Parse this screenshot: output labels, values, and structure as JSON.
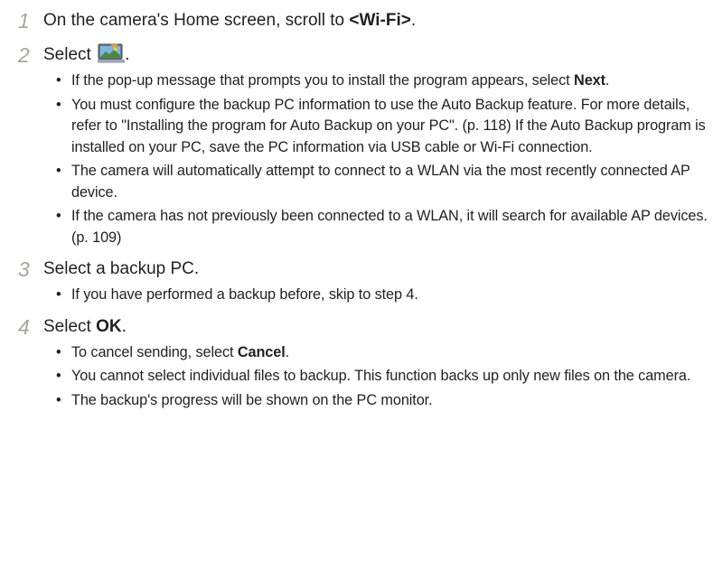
{
  "steps": [
    {
      "number": "1",
      "pre": "On the camera's Home screen, scroll to ",
      "bold": "<Wi-Fi>",
      "post": "."
    },
    {
      "number": "2",
      "pre": "Select ",
      "icon": "auto-backup-icon",
      "post": ".",
      "bullets": [
        {
          "pre": "If the pop-up message that prompts you to install the program appears, select ",
          "bold": "Next",
          "post": "."
        },
        {
          "pre": "You must configure the backup PC information to use the Auto Backup feature. For more details, refer to \"Installing the program for Auto Backup on your PC\". (p. 118) If the Auto Backup program is installed on your PC, save the PC information via USB cable or Wi-Fi connection."
        },
        {
          "pre": "The camera will automatically attempt to connect to a WLAN via the most recently connected AP device."
        },
        {
          "pre": "If the camera has not previously been connected to a WLAN, it will search for available AP devices. (p. 109)"
        }
      ]
    },
    {
      "number": "3",
      "pre": "Select a backup PC.",
      "bullets": [
        {
          "pre": "If you have performed a backup before, skip to step 4."
        }
      ]
    },
    {
      "number": "4",
      "pre": "Select ",
      "bold": "OK",
      "post": ".",
      "bullets": [
        {
          "pre": "To cancel sending, select ",
          "bold": "Cancel",
          "post": "."
        },
        {
          "pre": "You cannot select individual files to backup. This function backs up only new files on the camera."
        },
        {
          "pre": "The backup's progress will be shown on the PC monitor."
        }
      ]
    }
  ]
}
